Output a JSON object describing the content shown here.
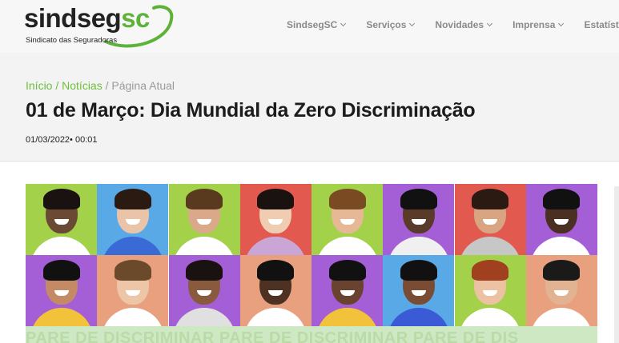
{
  "logo": {
    "name_main": "sindseg",
    "name_accent": "sc",
    "tagline": "Sindicato das Seguradoras"
  },
  "nav": [
    {
      "label": "SindsegSC"
    },
    {
      "label": "Serviços"
    },
    {
      "label": "Novidades"
    },
    {
      "label": "Imprensa"
    },
    {
      "label": "Estatíst"
    }
  ],
  "breadcrumb": {
    "home": "Início",
    "sep1": " / ",
    "section": "Notícias",
    "sep2": " / ",
    "current": "Página Atual"
  },
  "article": {
    "title": "01 de Março: Dia Mundial da Zero Discriminação",
    "date": "01/03/2022• 00:01"
  },
  "banner": {
    "text": "PARE DE DISCRIMINAR   PARE DE DISCRIMINAR PARE DE DIS"
  },
  "colors": {
    "accent": "#6cbf3c",
    "tiles_row1": [
      "#a3d24a",
      "#58a9e6",
      "#a3d24a",
      "#e25a4f",
      "#a3d24a",
      "#a55fd6",
      "#e25a4f",
      "#a55fd6"
    ],
    "tiles_row2": [
      "#a55fd6",
      "#e8a07e",
      "#a55fd6",
      "#e8a07e",
      "#a55fd6",
      "#58a9e6",
      "#a3d24a",
      "#e8a07e"
    ]
  }
}
